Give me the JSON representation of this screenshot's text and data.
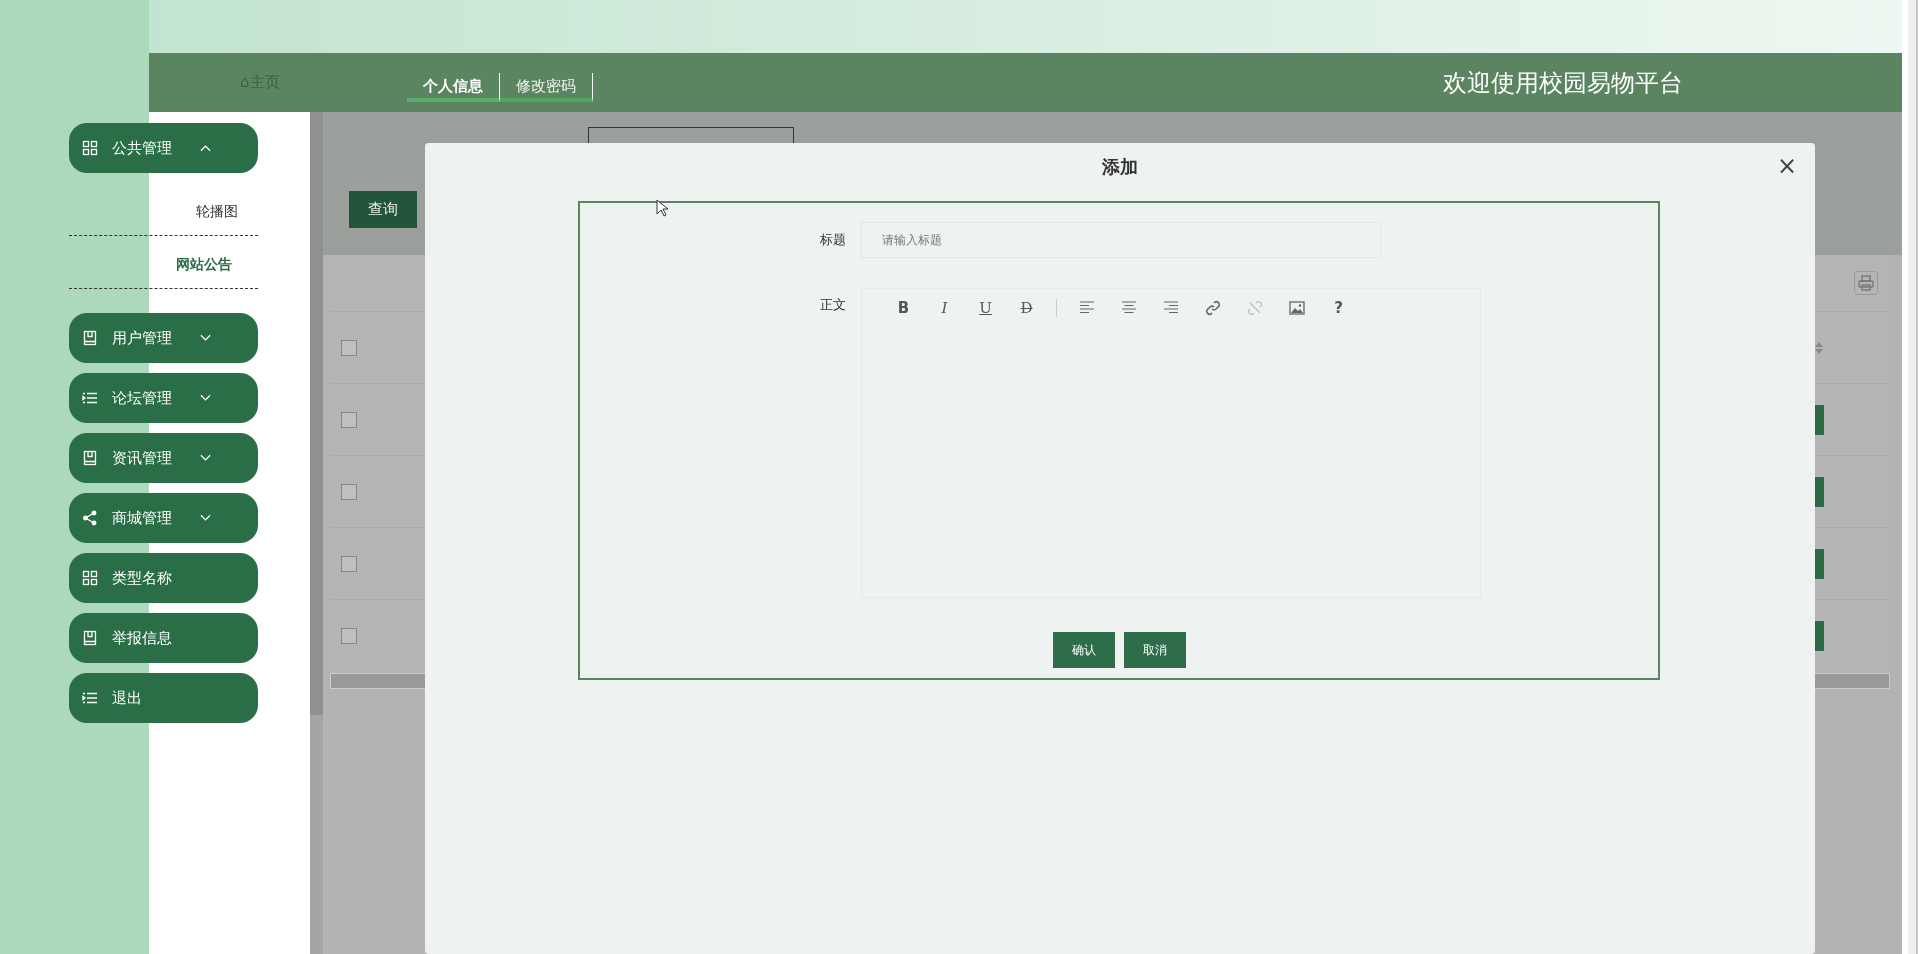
{
  "header": {
    "home": "⌂主页",
    "tabs": [
      {
        "label": "个人信息",
        "selected": true
      },
      {
        "label": "修改密码",
        "selected": false
      }
    ],
    "title": "欢迎使用校园易物平台"
  },
  "sidebar": [
    {
      "label": "公共管理",
      "expanded": true,
      "children": [
        {
          "label": "轮播图",
          "selected": false
        },
        {
          "label": "网站公告",
          "selected": true
        }
      ]
    },
    {
      "label": "用户管理",
      "expanded": false
    },
    {
      "label": "论坛管理",
      "expanded": false
    },
    {
      "label": "资讯管理",
      "expanded": false
    },
    {
      "label": "商城管理",
      "expanded": false
    },
    {
      "label": "类型名称"
    },
    {
      "label": "举报信息"
    },
    {
      "label": "退出"
    }
  ],
  "search": {
    "button": "查询"
  },
  "table": {
    "header_checked": false,
    "rows": [
      {
        "checked": false
      },
      {
        "checked": false
      },
      {
        "checked": false
      },
      {
        "checked": false
      }
    ]
  },
  "modal": {
    "title": "添加",
    "close": "×",
    "fields": [
      {
        "label": "标题",
        "kind": "input",
        "placeholder": "请输入标题"
      },
      {
        "label": "正文",
        "kind": "editor"
      }
    ],
    "toolbar": [
      {
        "kind": "bold",
        "label": "B"
      },
      {
        "kind": "italic",
        "label": "I"
      },
      {
        "kind": "underline",
        "label": "U"
      },
      {
        "kind": "strike",
        "label": "D"
      },
      {
        "kind": "separator"
      },
      {
        "kind": "align-left"
      },
      {
        "kind": "align-center"
      },
      {
        "kind": "align-right"
      },
      {
        "kind": "link"
      },
      {
        "kind": "unlink",
        "disabled": true
      },
      {
        "kind": "image"
      },
      {
        "kind": "help",
        "label": "?"
      }
    ],
    "buttons": [
      "确认",
      "取消"
    ]
  }
}
